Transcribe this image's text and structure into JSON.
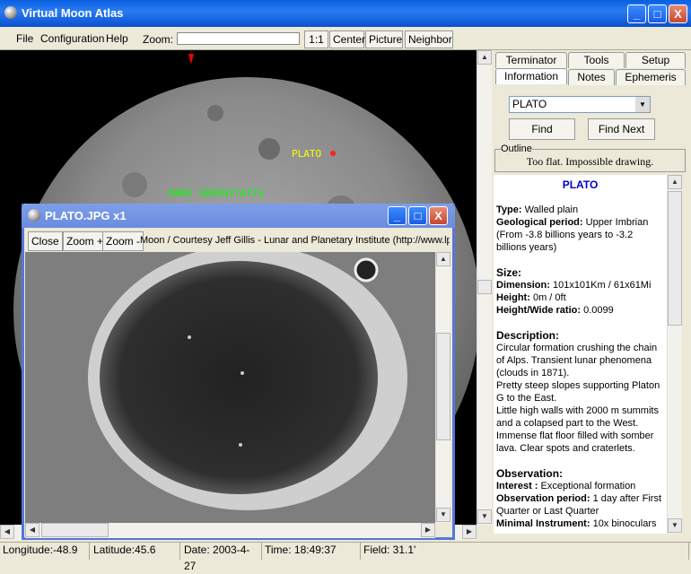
{
  "window": {
    "title": "Virtual Moon Atlas",
    "minimize": "_",
    "maximize": "□",
    "close": "X"
  },
  "menu": {
    "file": "File",
    "configuration": "Configuration",
    "help": "Help"
  },
  "toolbar": {
    "zoom_label": "Zoom:",
    "btn_1_1": "1:1",
    "btn_center": "Center",
    "btn_picture": "Picture",
    "btn_neighbor": "Neighbor"
  },
  "moon": {
    "plato_label": "PLATO",
    "mare_label": "MARE SERENITATIS"
  },
  "tabs": {
    "row1": [
      "Terminator",
      "Tools",
      "Setup"
    ],
    "row2": [
      "Information",
      "Notes",
      "Ephemeris"
    ]
  },
  "search": {
    "value": "PLATO",
    "find": "Find",
    "find_next": "Find Next"
  },
  "outline": {
    "label": "Outline",
    "text": "Too flat. Impossible drawing."
  },
  "info": {
    "name": "PLATO",
    "type_label": "Type:",
    "type_value": " Walled plain",
    "geo_label": "Geological period:",
    "geo_value": " Upper Imbrian (From -3.8 billions years to -3.2 billions years)",
    "size_heading": "Size:",
    "dim_label": "Dimension:",
    "dim_value": " 101x101Km / 61x61Mi",
    "height_label": "Height:",
    "height_value": " 0m / 0ft",
    "ratio_label": "Height/Wide ratio:",
    "ratio_value": " 0.0099",
    "desc_heading": "Description:",
    "desc_text": "Circular formation crushing the chain of Alps. Transient lunar phenomena (clouds in 1871).",
    "desc_text2": "Pretty steep slopes supporting Platon G to the East.",
    "desc_text3": "Little high walls with 2000 m summits and a colapsed part to the West. Immense flat floor filled with somber lava. Clear spots and craterlets.",
    "obs_heading": "Observation:",
    "interest_label": "Interest :",
    "interest_value": " Exceptional formation",
    "period_label": "Observation period:",
    "period_value": " 1 day after First Quarter or Last Quarter",
    "instr_label": "Minimal Instrument:",
    "instr_value": " 10x binoculars"
  },
  "child": {
    "title": "PLATO.JPG x1",
    "close": "Close",
    "zoom_in": "Zoom +",
    "zoom_out": "Zoom -",
    "caption": "Moon / Courtesy Jeff Gillis - Lunar and Planetary Institute (http://www.lp"
  },
  "status": {
    "longitude": "Longitude:-48.9",
    "latitude": "Latitude:45.6",
    "date": "Date: 2003-4-27",
    "time": "Time: 18:49:37",
    "field": "Field: 31.1'"
  },
  "colors": {
    "plato_label": "#ffff00",
    "mare_label": "#00ff00",
    "info_title": "#0000cc"
  }
}
